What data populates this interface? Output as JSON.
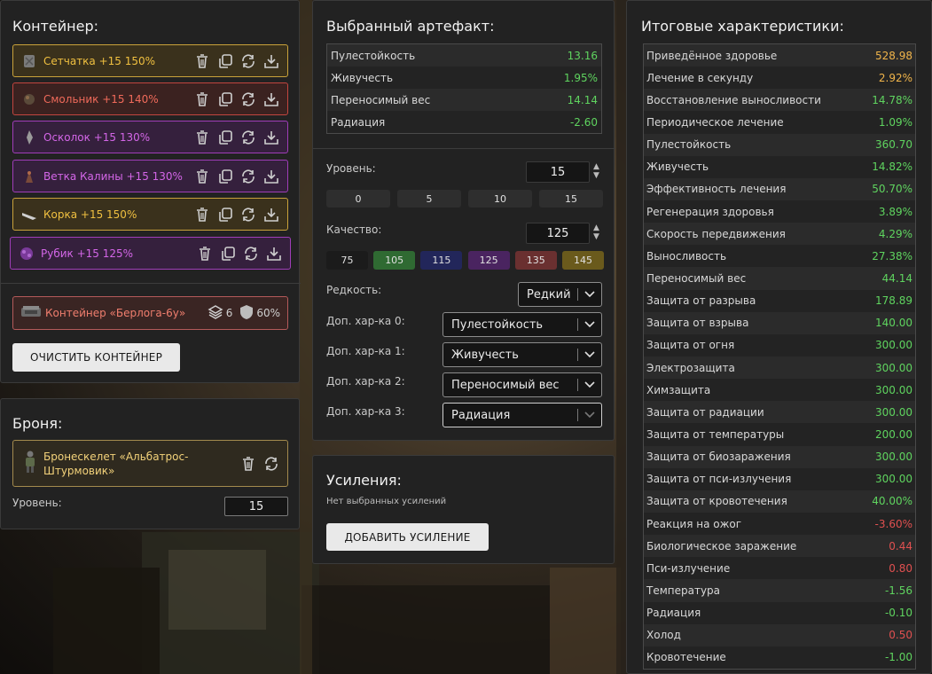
{
  "container": {
    "title": "Контейнер:",
    "artifacts": [
      {
        "name": "Сетчатка +15 150%",
        "color": "#f0c040",
        "border": "#c9a23a",
        "bg": "#3a311c"
      },
      {
        "name": "Смольник +15 140%",
        "color": "#f06a5a",
        "border": "#c2453f",
        "bg": "#3b2220"
      },
      {
        "name": "Осколок +15 130%",
        "color": "#d466e8",
        "border": "#9f3db8",
        "bg": "#35203d"
      },
      {
        "name": "Ветка Калины +15 130%",
        "color": "#d466e8",
        "border": "#9f3db8",
        "bg": "#35203d"
      },
      {
        "name": "Корка +15 150%",
        "color": "#f0c040",
        "border": "#c9a23a",
        "bg": "#3a311c"
      },
      {
        "name": "Рубик +15 125%",
        "color": "#d466e8",
        "border": "#9f3db8",
        "bg": "#35203d"
      }
    ],
    "container_item": {
      "name": "Контейнер «Берлога-6у»",
      "slots": "6",
      "protection": "60%"
    },
    "clear_label": "ОЧИСТИТЬ КОНТЕЙНЕР"
  },
  "armor": {
    "title": "Броня:",
    "name": "Бронескелет «Альбатрос-Штурмовик»",
    "level_label": "Уровень:",
    "level": "15"
  },
  "selected": {
    "title": "Выбранный артефакт:",
    "stats": [
      {
        "name": "Пулестойкость",
        "value": "13.16",
        "kind": "pos"
      },
      {
        "name": "Живучесть",
        "value": "1.95%",
        "kind": "pos"
      },
      {
        "name": "Переносимый вес",
        "value": "14.14",
        "kind": "pos"
      },
      {
        "name": "Радиация",
        "value": "-2.60",
        "kind": "pos"
      }
    ],
    "level_label": "Уровень:",
    "level": "15",
    "level_presets": [
      "0",
      "5",
      "10",
      "15"
    ],
    "quality_label": "Качество:",
    "quality": "125",
    "quality_presets": [
      {
        "label": "75",
        "bg": "#1b1b1b"
      },
      {
        "label": "105",
        "bg": "#2f6a32"
      },
      {
        "label": "115",
        "bg": "#22265a"
      },
      {
        "label": "125",
        "bg": "#4a2460"
      },
      {
        "label": "135",
        "bg": "#6a3030"
      },
      {
        "label": "145",
        "bg": "#6a5a1c"
      }
    ],
    "rarity_label": "Редкость:",
    "rarity": "Редкий",
    "extra": [
      {
        "label": "Доп. хар-ка 0:",
        "value": "Пулестойкость"
      },
      {
        "label": "Доп. хар-ка 1:",
        "value": "Живучесть"
      },
      {
        "label": "Доп. хар-ка 2:",
        "value": "Переносимый вес"
      },
      {
        "label": "Доп. хар-ка 3:",
        "value": "Радиация"
      }
    ]
  },
  "boosts": {
    "title": "Усиления:",
    "empty_text": "Нет выбранных усилений",
    "add_label": "ДОБАВИТЬ УСИЛЕНИЕ"
  },
  "totals": {
    "title": "Итоговые характеристики:",
    "rows": [
      {
        "name": "Приведённое здоровье",
        "value": "528.98",
        "kind": "gold"
      },
      {
        "name": "Лечение в секунду",
        "value": "2.92%",
        "kind": "gold"
      },
      {
        "name": "Восстановление выносливости",
        "value": "14.78%",
        "kind": "pos"
      },
      {
        "name": "Периодическое лечение",
        "value": "1.09%",
        "kind": "pos"
      },
      {
        "name": "Пулестойкость",
        "value": "360.70",
        "kind": "pos"
      },
      {
        "name": "Живучесть",
        "value": "14.82%",
        "kind": "pos"
      },
      {
        "name": "Эффективность лечения",
        "value": "50.70%",
        "kind": "pos"
      },
      {
        "name": "Регенерация здоровья",
        "value": "3.89%",
        "kind": "pos"
      },
      {
        "name": "Скорость передвижения",
        "value": "4.29%",
        "kind": "pos"
      },
      {
        "name": "Выносливость",
        "value": "27.38%",
        "kind": "pos"
      },
      {
        "name": "Переносимый вес",
        "value": "44.14",
        "kind": "pos"
      },
      {
        "name": "Защита от разрыва",
        "value": "178.89",
        "kind": "pos"
      },
      {
        "name": "Защита от взрыва",
        "value": "140.00",
        "kind": "pos"
      },
      {
        "name": "Защита от огня",
        "value": "300.00",
        "kind": "pos"
      },
      {
        "name": "Электрозащита",
        "value": "300.00",
        "kind": "pos"
      },
      {
        "name": "Химзащита",
        "value": "300.00",
        "kind": "pos"
      },
      {
        "name": "Защита от радиации",
        "value": "300.00",
        "kind": "pos"
      },
      {
        "name": "Защита от температуры",
        "value": "200.00",
        "kind": "pos"
      },
      {
        "name": "Защита от биозаражения",
        "value": "300.00",
        "kind": "pos"
      },
      {
        "name": "Защита от пси-излучения",
        "value": "300.00",
        "kind": "pos"
      },
      {
        "name": "Защита от кровотечения",
        "value": "40.00%",
        "kind": "pos"
      },
      {
        "name": "Реакция на ожог",
        "value": "-3.60%",
        "kind": "neg"
      },
      {
        "name": "Биологическое заражение",
        "value": "0.44",
        "kind": "neg"
      },
      {
        "name": "Пси-излучение",
        "value": "0.80",
        "kind": "neg"
      },
      {
        "name": "Температура",
        "value": "-1.56",
        "kind": "pos"
      },
      {
        "name": "Радиация",
        "value": "-0.10",
        "kind": "pos"
      },
      {
        "name": "Холод",
        "value": "0.50",
        "kind": "neg"
      },
      {
        "name": "Кровотечение",
        "value": "-1.00",
        "kind": "pos"
      }
    ]
  }
}
